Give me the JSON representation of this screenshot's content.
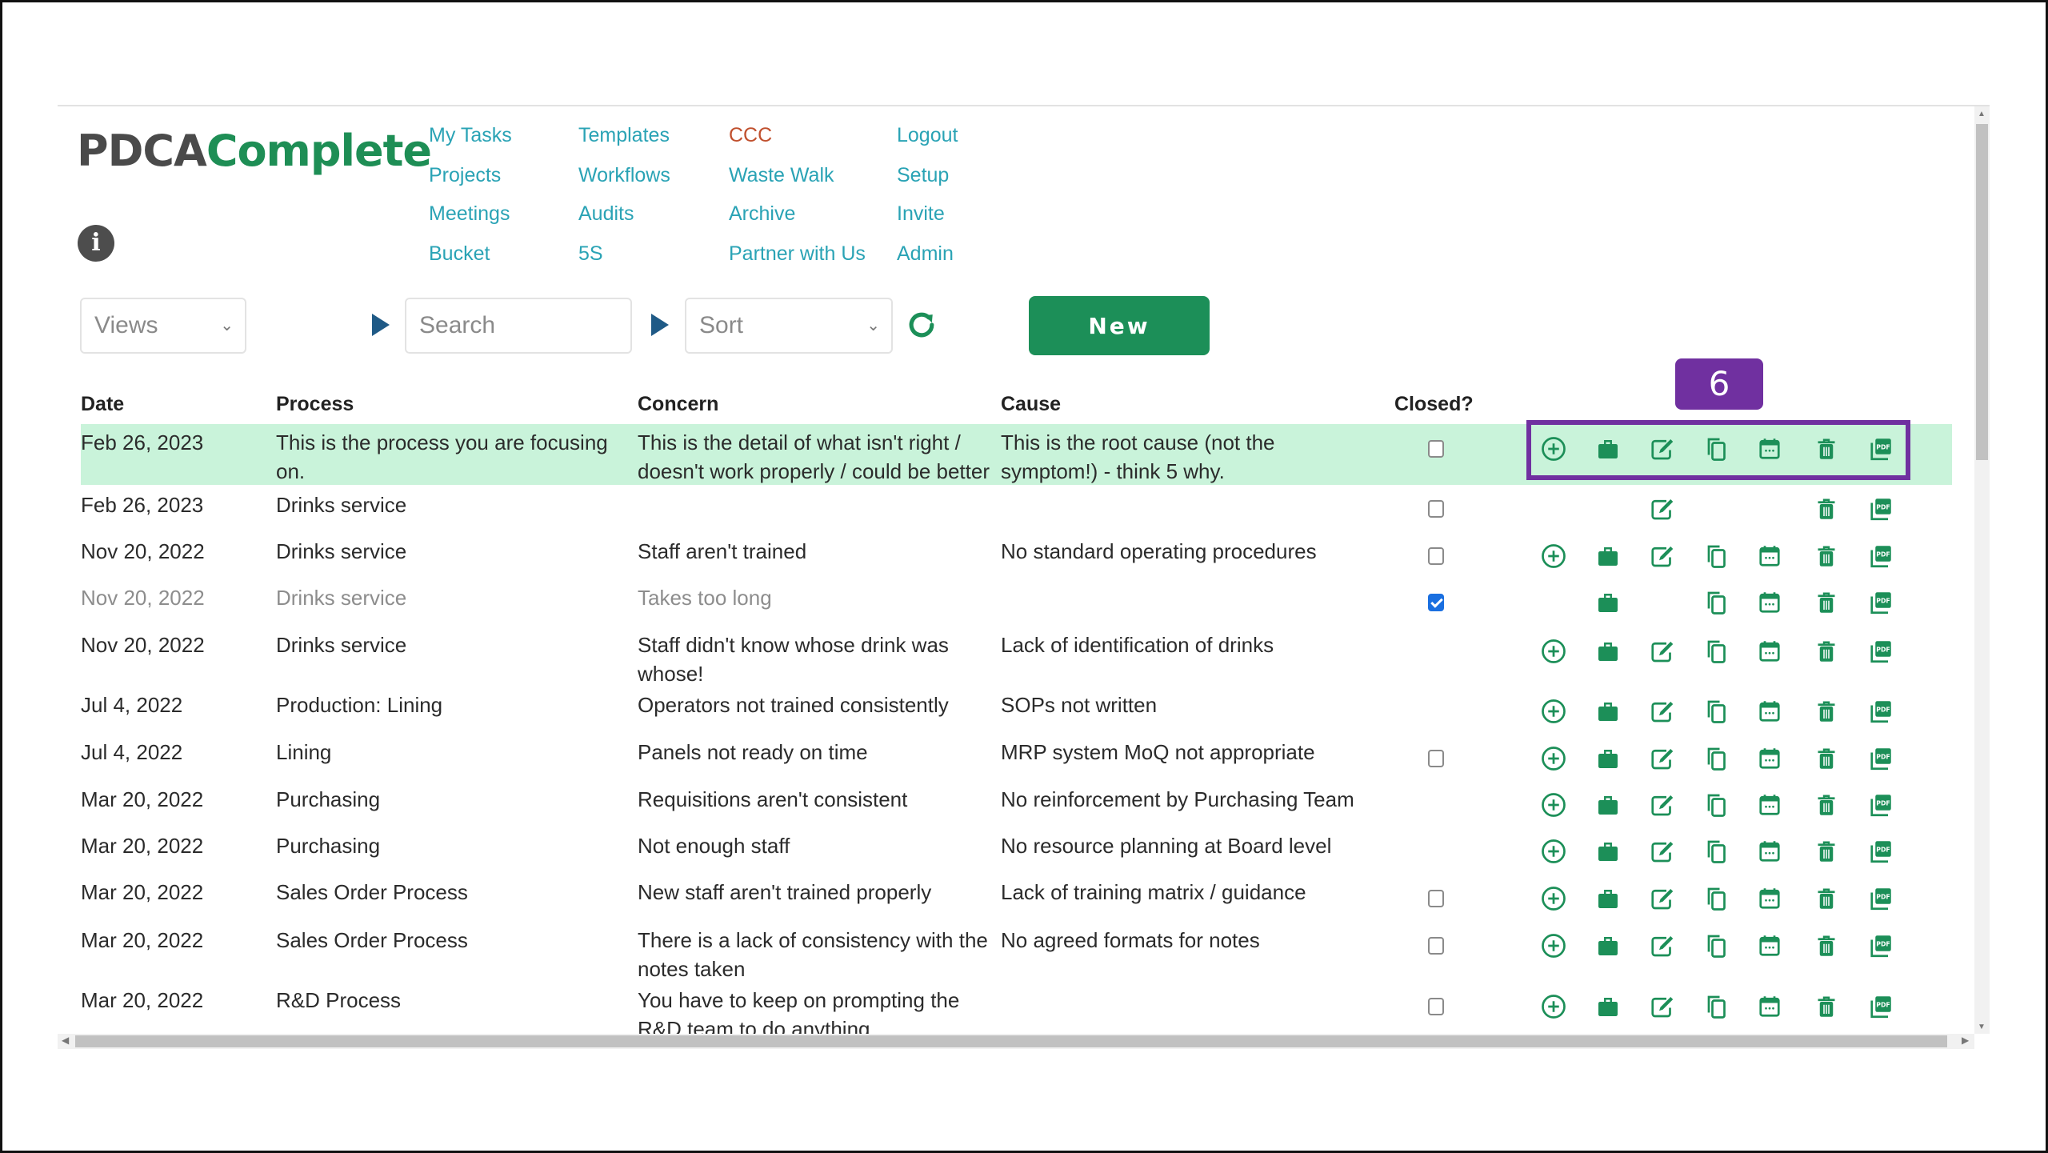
{
  "app": {
    "logo_part1": "PDCA",
    "logo_part2": "Complete",
    "info_label": "i"
  },
  "nav": {
    "col1": [
      "My Tasks",
      "Projects",
      "Meetings",
      "Bucket"
    ],
    "col2": [
      "Templates",
      "Workflows",
      "Audits",
      "5S"
    ],
    "col3": [
      "CCC",
      "Waste Walk",
      "Archive",
      "Partner with Us"
    ],
    "col4": [
      "Logout",
      "Setup",
      "Invite",
      "Admin"
    ]
  },
  "toolbar": {
    "views_placeholder": "Views",
    "search_placeholder": "Search",
    "sort_placeholder": "Sort",
    "new_label": "New"
  },
  "table": {
    "headers": [
      "Date",
      "Process",
      "Concern",
      "Cause",
      "Closed?"
    ],
    "rows": [
      {
        "date": "Feb 26, 2023",
        "process": "This is the process you are focusing on.",
        "concern": "This is the detail of what isn't right / doesn't work properly / could be better",
        "cause": "This is the root cause (not the symptom!) - think 5 why.",
        "checkbox": "unchecked",
        "icons": [
          "add",
          "briefcase",
          "edit",
          "copy",
          "calendar",
          "delete",
          "pdf"
        ],
        "highlighted": true
      },
      {
        "date": "Feb 26, 2023",
        "process": "Drinks service",
        "concern": "",
        "cause": "",
        "checkbox": "unchecked",
        "icons": [
          "edit",
          "delete",
          "pdf"
        ]
      },
      {
        "date": "Nov 20, 2022",
        "process": "Drinks service",
        "concern": "Staff aren't trained",
        "cause": "No standard operating procedures",
        "checkbox": "unchecked",
        "icons": [
          "add",
          "briefcase",
          "edit",
          "copy",
          "calendar",
          "delete",
          "pdf"
        ]
      },
      {
        "date": "Nov 20, 2022",
        "process": "Drinks service",
        "concern": "Takes too long",
        "cause": "",
        "checkbox": "checked",
        "icons": [
          "briefcase",
          "copy",
          "calendar",
          "delete",
          "pdf"
        ],
        "dimmed": true
      },
      {
        "date": "Nov 20, 2022",
        "process": "Drinks service",
        "concern": "Staff didn't know whose drink was whose!",
        "cause": "Lack of identification of drinks",
        "checkbox": "none",
        "icons": [
          "add",
          "briefcase",
          "edit",
          "copy",
          "calendar",
          "delete",
          "pdf"
        ]
      },
      {
        "date": "Jul 4, 2022",
        "process": "Production: Lining",
        "concern": "Operators not trained consistently",
        "cause": "SOPs not written",
        "checkbox": "none",
        "icons": [
          "add",
          "briefcase",
          "edit",
          "copy",
          "calendar",
          "delete",
          "pdf"
        ]
      },
      {
        "date": "Jul 4, 2022",
        "process": "Lining",
        "concern": "Panels not ready on time",
        "cause": "MRP system MoQ not appropriate",
        "checkbox": "unchecked",
        "icons": [
          "add",
          "briefcase",
          "edit",
          "copy",
          "calendar",
          "delete",
          "pdf"
        ]
      },
      {
        "date": "Mar 20, 2022",
        "process": "Purchasing",
        "concern": "Requisitions aren't consistent",
        "cause": "No reinforcement by Purchasing Team",
        "checkbox": "none",
        "icons": [
          "add",
          "briefcase",
          "edit",
          "copy",
          "calendar",
          "delete",
          "pdf"
        ]
      },
      {
        "date": "Mar 20, 2022",
        "process": "Purchasing",
        "concern": "Not enough staff",
        "cause": "No resource planning at Board level",
        "checkbox": "none",
        "icons": [
          "add",
          "briefcase",
          "edit",
          "copy",
          "calendar",
          "delete",
          "pdf"
        ]
      },
      {
        "date": "Mar 20, 2022",
        "process": "Sales Order Process",
        "concern": "New staff aren't trained properly",
        "cause": "Lack of training matrix / guidance",
        "checkbox": "unchecked",
        "icons": [
          "add",
          "briefcase",
          "edit",
          "copy",
          "calendar",
          "delete",
          "pdf"
        ]
      },
      {
        "date": "Mar 20, 2022",
        "process": "Sales Order Process",
        "concern": "There is a lack of consistency with the notes taken",
        "cause": "No agreed formats for notes",
        "checkbox": "unchecked",
        "icons": [
          "add",
          "briefcase",
          "edit",
          "copy",
          "calendar",
          "delete",
          "pdf"
        ]
      },
      {
        "date": "Mar 20, 2022",
        "process": "R&D Process",
        "concern": "You have to keep on prompting the R&D team to do anything",
        "cause": "",
        "checkbox": "unchecked",
        "icons": [
          "add",
          "briefcase",
          "edit",
          "copy",
          "calendar",
          "delete",
          "pdf"
        ]
      }
    ]
  },
  "annotation": {
    "badge_number": "6"
  },
  "colors": {
    "brand_green": "#1c8f58",
    "nav_link": "#2aa3b5",
    "ccc_link": "#c0502e",
    "row_highlight": "#c9f3da",
    "annotation_purple": "#7030a0"
  }
}
